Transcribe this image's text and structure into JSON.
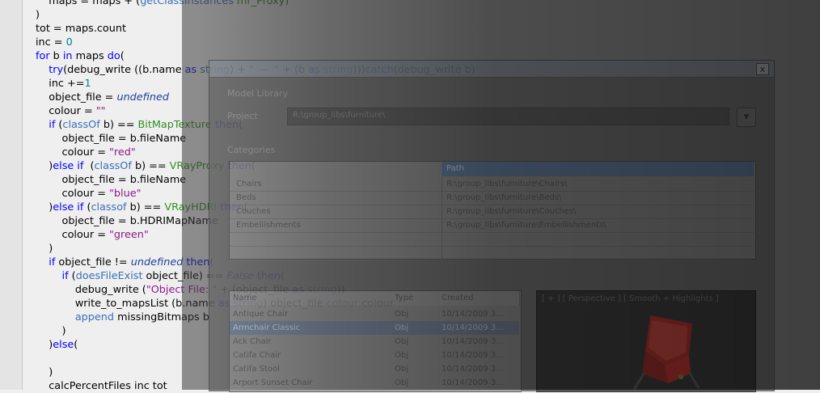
{
  "editor": {
    "lines": [
      [
        {
          "t": "    maps = maps + (",
          "c": "plain"
        },
        {
          "t": "getClassInstances",
          "c": "fn"
        },
        {
          "t": " mr_Proxy)",
          "c": "cls"
        }
      ],
      [
        {
          "t": ")",
          "c": "plain"
        }
      ],
      [
        {
          "t": "tot = maps.count",
          "c": "plain"
        }
      ],
      [
        {
          "t": "inc = ",
          "c": "plain"
        },
        {
          "t": "0",
          "c": "num"
        }
      ],
      [
        {
          "t": "for",
          "c": "kw"
        },
        {
          "t": " b ",
          "c": "plain"
        },
        {
          "t": "in",
          "c": "kw"
        },
        {
          "t": " maps ",
          "c": "plain"
        },
        {
          "t": "do",
          "c": "kw"
        },
        {
          "t": "(",
          "c": "plain"
        }
      ],
      [
        {
          "t": "    ",
          "c": "plain"
        },
        {
          "t": "try",
          "c": "kw"
        },
        {
          "t": "(debug_write ((b.name ",
          "c": "plain"
        },
        {
          "t": "as",
          "c": "kw"
        },
        {
          "t": " ",
          "c": "plain"
        },
        {
          "t": "string",
          "c": "fn"
        },
        {
          "t": ") + ",
          "c": "plain"
        },
        {
          "t": "\"  --  \"",
          "c": "str"
        },
        {
          "t": " + (b ",
          "c": "plain"
        },
        {
          "t": "as",
          "c": "kw"
        },
        {
          "t": " ",
          "c": "plain"
        },
        {
          "t": "string",
          "c": "fn"
        },
        {
          "t": ")))",
          "c": "plain"
        },
        {
          "t": "catch",
          "c": "kw"
        },
        {
          "t": "(debug_write b)",
          "c": "plain"
        }
      ],
      [
        {
          "t": "    inc +=",
          "c": "plain"
        },
        {
          "t": "1",
          "c": "num"
        }
      ],
      [
        {
          "t": "    object_file = ",
          "c": "plain"
        },
        {
          "t": "undefined",
          "c": "it"
        }
      ],
      [
        {
          "t": "    colour = ",
          "c": "plain"
        },
        {
          "t": "\"\"",
          "c": "str"
        }
      ],
      [
        {
          "t": "    ",
          "c": "plain"
        },
        {
          "t": "if",
          "c": "kw"
        },
        {
          "t": " (",
          "c": "plain"
        },
        {
          "t": "classOf",
          "c": "fn"
        },
        {
          "t": " b) == ",
          "c": "plain"
        },
        {
          "t": "BitMapTexture",
          "c": "cls"
        },
        {
          "t": " ",
          "c": "plain"
        },
        {
          "t": "then",
          "c": "kw"
        },
        {
          "t": "(",
          "c": "plain"
        }
      ],
      [
        {
          "t": "        object_file = b.fileName",
          "c": "plain"
        }
      ],
      [
        {
          "t": "        colour = ",
          "c": "plain"
        },
        {
          "t": "\"red\"",
          "c": "str"
        }
      ],
      [
        {
          "t": "    )",
          "c": "plain"
        },
        {
          "t": "else if",
          "c": "kw"
        },
        {
          "t": "  (",
          "c": "plain"
        },
        {
          "t": "classOf",
          "c": "fn"
        },
        {
          "t": " b) == ",
          "c": "plain"
        },
        {
          "t": "VRayProxy",
          "c": "cls"
        },
        {
          "t": " ",
          "c": "plain"
        },
        {
          "t": "then",
          "c": "kw"
        },
        {
          "t": "(",
          "c": "plain"
        }
      ],
      [
        {
          "t": "        object_file = b.fileName",
          "c": "plain"
        }
      ],
      [
        {
          "t": "        colour = ",
          "c": "plain"
        },
        {
          "t": "\"blue\"",
          "c": "str"
        }
      ],
      [
        {
          "t": "    )",
          "c": "plain"
        },
        {
          "t": "else if",
          "c": "kw"
        },
        {
          "t": " (",
          "c": "plain"
        },
        {
          "t": "classof",
          "c": "fn"
        },
        {
          "t": " b) == ",
          "c": "plain"
        },
        {
          "t": "VRayHDRI",
          "c": "cls"
        },
        {
          "t": " ",
          "c": "plain"
        },
        {
          "t": "then",
          "c": "kw"
        },
        {
          "t": "(",
          "c": "plain"
        }
      ],
      [
        {
          "t": "        object_file = b.HDRIMapName",
          "c": "plain"
        }
      ],
      [
        {
          "t": "        colour = ",
          "c": "plain"
        },
        {
          "t": "\"green\"",
          "c": "str"
        }
      ],
      [
        {
          "t": "    )",
          "c": "plain"
        }
      ],
      [
        {
          "t": "    ",
          "c": "plain"
        },
        {
          "t": "if",
          "c": "kw"
        },
        {
          "t": " object_file != ",
          "c": "plain"
        },
        {
          "t": "undefined",
          "c": "it"
        },
        {
          "t": " ",
          "c": "plain"
        },
        {
          "t": "then",
          "c": "kw"
        },
        {
          "t": "(",
          "c": "plain"
        }
      ],
      [
        {
          "t": "        ",
          "c": "plain"
        },
        {
          "t": "if",
          "c": "kw"
        },
        {
          "t": " (",
          "c": "plain"
        },
        {
          "t": "doesFileExist",
          "c": "fn"
        },
        {
          "t": " object_file) == ",
          "c": "plain"
        },
        {
          "t": "False",
          "c": "it"
        },
        {
          "t": " ",
          "c": "plain"
        },
        {
          "t": "then",
          "c": "kw"
        },
        {
          "t": "(",
          "c": "plain"
        }
      ],
      [
        {
          "t": "            debug_write (",
          "c": "plain"
        },
        {
          "t": "\"Object File: \"",
          "c": "str"
        },
        {
          "t": " + (object_file ",
          "c": "plain"
        },
        {
          "t": "as",
          "c": "kw"
        },
        {
          "t": " ",
          "c": "plain"
        },
        {
          "t": "string",
          "c": "fn"
        },
        {
          "t": "))",
          "c": "plain"
        }
      ],
      [
        {
          "t": "            write_to_mapsList (b.name ",
          "c": "plain"
        },
        {
          "t": "as",
          "c": "kw"
        },
        {
          "t": " ",
          "c": "plain"
        },
        {
          "t": "string",
          "c": "fn"
        },
        {
          "t": ") object_file ",
          "c": "plain"
        },
        {
          "t": "colour:",
          "c": "fn-purple"
        },
        {
          "t": "colour",
          "c": "plain"
        }
      ],
      [
        {
          "t": "            ",
          "c": "plain"
        },
        {
          "t": "append",
          "c": "fn"
        },
        {
          "t": " missingBitmaps b",
          "c": "plain"
        }
      ],
      [
        {
          "t": "        )",
          "c": "plain"
        }
      ],
      [
        {
          "t": "    )",
          "c": "plain"
        },
        {
          "t": "else",
          "c": "kw"
        },
        {
          "t": "(",
          "c": "plain"
        }
      ],
      [
        {
          "t": "",
          "c": "plain"
        }
      ],
      [
        {
          "t": "    )",
          "c": "plain"
        }
      ],
      [
        {
          "t": "    calcPercentFiles inc tot",
          "c": "plain"
        }
      ]
    ]
  },
  "window": {
    "close_glyph": "x",
    "labels": {
      "library": "Model Library",
      "project": "Project",
      "categories": "Categories"
    },
    "combo_value": "R:\\group_libs\\furniture\\",
    "categories_header": "Path",
    "categories": [
      {
        "name": "Chairs",
        "path": "R:\\group_libs\\furniture\\Chairs\\"
      },
      {
        "name": "Beds",
        "path": "R:\\group_libs\\furniture\\Beds\\"
      },
      {
        "name": "Couches",
        "path": "R:\\group_libs\\furniture\\Couches\\"
      },
      {
        "name": "Embellishments",
        "path": "R:\\group_libs\\furniture\\Embellishments\\"
      }
    ],
    "models_headers": [
      "Name",
      "Type",
      "Created"
    ],
    "models": [
      {
        "name": "Antique Chair",
        "type": "Obj",
        "created": "10/14/2009 3..."
      },
      {
        "name": "Armchair Classic",
        "type": "Obj",
        "created": "10/14/2009 3...",
        "selected": true
      },
      {
        "name": "Ack Chair",
        "type": "Obj",
        "created": "10/14/2009 3..."
      },
      {
        "name": "Catifa Chair",
        "type": "Obj",
        "created": "10/14/2009 3..."
      },
      {
        "name": "Catifa Stool",
        "type": "Obj",
        "created": "10/14/2009 3..."
      },
      {
        "name": "Arport Sunset Chair",
        "type": "Obj",
        "created": "10/14/2009 3..."
      }
    ],
    "viewport_label": "[ + ] [ Perspective ] [ Smooth + Highlights ]"
  },
  "colors": {
    "keyword": "#0000ff",
    "function": "#3a6eb8",
    "string": "#8b1a8b",
    "class": "#2f8f1f",
    "number": "#00828a",
    "chair": "#d8231e"
  }
}
